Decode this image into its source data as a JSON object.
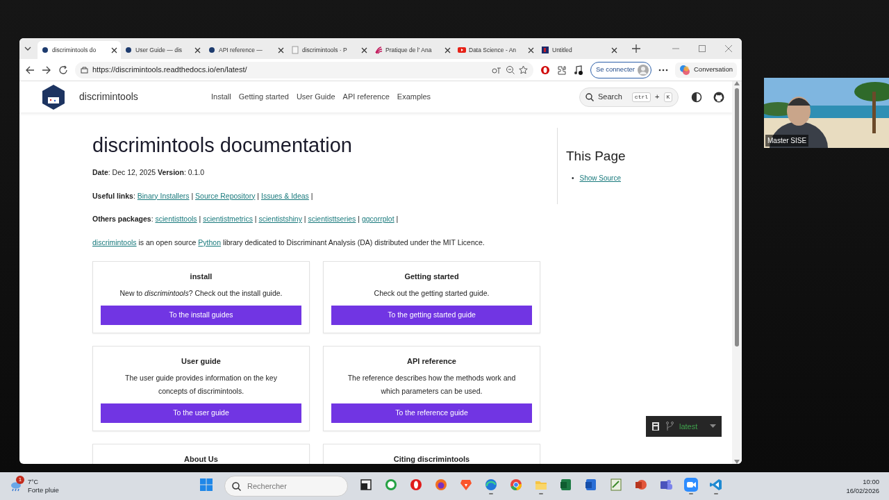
{
  "browser": {
    "tabs": [
      {
        "title": "discrimintools do",
        "kind": "docs",
        "selected": true
      },
      {
        "title": "User Guide — dis",
        "kind": "docs",
        "selected": false
      },
      {
        "title": "API reference — ",
        "kind": "docs",
        "selected": false
      },
      {
        "title": "discrimintools · P",
        "kind": "blank",
        "selected": false
      },
      {
        "title": "Pratique de l' Ana",
        "kind": "swirl",
        "selected": false
      },
      {
        "title": "Data Science - An",
        "kind": "video",
        "selected": false
      },
      {
        "title": "Untitled",
        "kind": "square",
        "selected": false
      }
    ],
    "address": "https://discrimintools.readthedocs.io/en/latest/",
    "signin": "Se connecter",
    "assistant": "Conversation"
  },
  "site": {
    "brand": "discrimintools",
    "nav": [
      "Install",
      "Getting started",
      "User Guide",
      "API reference",
      "Examples"
    ],
    "search": {
      "label": "Search",
      "keys": [
        "ctrl",
        "+",
        "K"
      ]
    }
  },
  "article": {
    "title": "discrimintools documentation",
    "meta": "**Date**: Dec 12, 2025 **Version**: 0.1.0",
    "paragraphs": [
      [
        {
          "kind": "text",
          "text": "**Useful links**: "
        },
        {
          "kind": "link",
          "text": "Binary Installers"
        },
        {
          "kind": "text",
          "text": " | "
        },
        {
          "kind": "link",
          "text": "Source Repository"
        },
        {
          "kind": "text",
          "text": " | "
        },
        {
          "kind": "link",
          "text": "Issues & Ideas"
        },
        {
          "kind": "text",
          "text": " |"
        }
      ],
      [
        {
          "kind": "text",
          "text": "**Others packages**: "
        },
        {
          "kind": "link",
          "text": "scientisttools"
        },
        {
          "kind": "text",
          "text": " | "
        },
        {
          "kind": "link",
          "text": "scientistmetrics"
        },
        {
          "kind": "text",
          "text": " | "
        },
        {
          "kind": "link",
          "text": "scientistshiny"
        },
        {
          "kind": "text",
          "text": " | "
        },
        {
          "kind": "link",
          "text": "scientisttseries"
        },
        {
          "kind": "text",
          "text": " | "
        },
        {
          "kind": "link",
          "text": "ggcorrplot"
        },
        {
          "kind": "text",
          "text": " |"
        }
      ],
      [
        {
          "kind": "link",
          "text": "discrimintools"
        },
        {
          "kind": "text",
          "text": " is an open source "
        },
        {
          "kind": "link",
          "text": "Python"
        },
        {
          "kind": "text",
          "text": " library dedicated to Discriminant Analysis (DA) distributed under the MIT Licence."
        }
      ]
    ],
    "cards": [
      {
        "title": "install",
        "text": "New to *discrimintools*? Check out the install guide.",
        "button": "To the install guides"
      },
      {
        "title": "Getting started",
        "text": "Check out the getting started guide.",
        "button": "To the getting started guide"
      },
      {
        "title": "User guide",
        "text": "The user guide provides information on the key concepts of discrimintools.",
        "button": "To the user guide"
      },
      {
        "title": "API reference",
        "text": "The reference describes how the methods work and which parameters can be used.",
        "button": "To the reference guide"
      },
      {
        "title": "About Us"
      },
      {
        "title": "Citing discrimintools"
      }
    ]
  },
  "sidebar": {
    "heading": "This Page",
    "links": [
      {
        "marker": "•",
        "text": "Show Source"
      }
    ]
  },
  "version_menu": {
    "label": "latest"
  },
  "video": {
    "label": "Master SISE"
  },
  "taskbar": {
    "weather": {
      "temp": "7°C",
      "text": "Forte pluie",
      "badge": "1"
    },
    "search": {
      "placeholder": "Rechercher"
    },
    "apps": [
      {
        "kind": "taskview",
        "running": false
      },
      {
        "kind": "chat",
        "running": false
      },
      {
        "kind": "ring",
        "running": false
      },
      {
        "kind": "fox",
        "running": false
      },
      {
        "kind": "lion",
        "running": false
      },
      {
        "kind": "wave",
        "running": true
      },
      {
        "kind": "chrome",
        "running": false
      },
      {
        "kind": "folder",
        "running": true
      },
      {
        "kind": "sheet",
        "running": false
      },
      {
        "kind": "doc",
        "running": false
      },
      {
        "kind": "note",
        "running": false
      },
      {
        "kind": "slides",
        "running": false
      },
      {
        "kind": "team",
        "running": false
      },
      {
        "kind": "zm",
        "running": true
      },
      {
        "kind": "code",
        "running": true
      }
    ],
    "time": "10:00",
    "date": "16/02/2026"
  }
}
